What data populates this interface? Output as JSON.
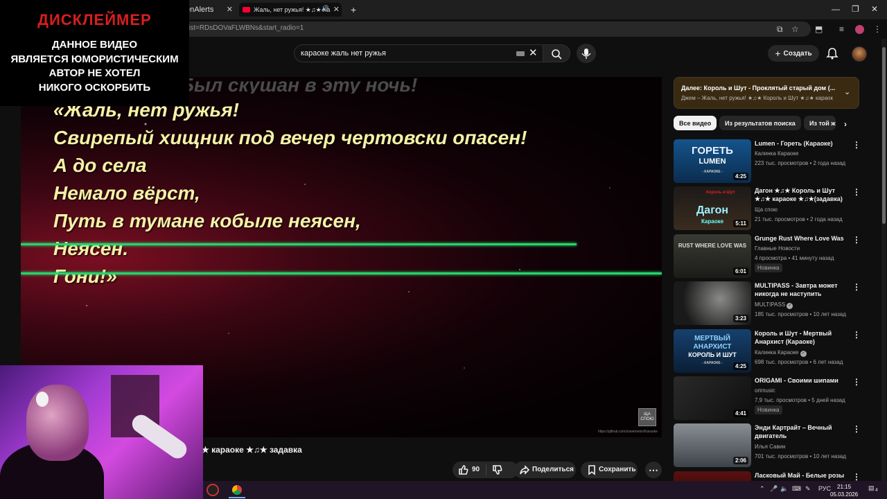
{
  "browser": {
    "tabs": [
      {
        "label": "enAlerts"
      },
      {
        "label": "Жаль, нет ружья! ★♫★ Ка"
      }
    ],
    "url": "ist=RDsDOVaFLWBNs&start_radio=1"
  },
  "header": {
    "search_query": "караоке жаль нет ружья",
    "create_label": "Создать"
  },
  "disclaimer": {
    "title": "ДИСКЛЕЙМЕР",
    "lines": [
      "ДАННОЕ ВИДЕО",
      "ЯВЛЯЕТСЯ ЮМОРИСТИЧЕСКИМ",
      "АВТОР НЕ ХОТЕЛ",
      "НИКОГО ОСКОРБИТЬ"
    ]
  },
  "player": {
    "prev_line": "Был скушан в эту ночь!",
    "lyrics": [
      "«Жаль, нет ружья!",
      "Свирепый хищник под вечер чертовски опасен!",
      "А до села",
      "Немало вёрст,",
      "Путь в тумане кобыле неясен,",
      "Неясен.",
      "Гони!»"
    ],
    "channel_badge": "ЩА СПОЮ",
    "small_url": "https://github.com/zowemenix/Karaoke"
  },
  "video": {
    "title": "★ караоке ★♫★ задавка",
    "likes": "90",
    "share_label": "Поделиться",
    "save_label": "Сохранить"
  },
  "upnext": {
    "title": "Далее: Король и Шут - Проклятый старый дом (...",
    "subtitle": "Джем – Жаль, нет ружья! ★♫★ Король и Шут ★♫★ караок"
  },
  "chips": [
    "Все видео",
    "Из результатов поиска",
    "Из той ж"
  ],
  "recommendations": [
    {
      "title": "Lumen - Гореть (Караоке)",
      "channel": "Калинка Караоке",
      "meta": "223 тыс. просмотров • 2 года назад",
      "duration": "4:25",
      "thumb_lines": [
        "ГОРЕТЬ",
        "LUMEN",
        "- КАРАОКЕ -"
      ]
    },
    {
      "title": "Дагон ★♫★ Король и Шут ★♫★ караоке ★♫★(задавка)",
      "channel": "Ща спою",
      "meta": "21 тыс. просмотров • 2 года назад",
      "duration": "5:11",
      "thumb_lines": [
        "Король и Шут",
        "Дагон",
        "Караоке"
      ]
    },
    {
      "title": "Grunge Rust Where Love Was",
      "channel": "Главные Новости",
      "meta": "4 просмотра • 41 минуту назад",
      "duration": "6:01",
      "badge": "Новинка",
      "thumb_lines": [
        "RUST WHERE LOVE WAS"
      ]
    },
    {
      "title": "MULTIPASS - Завтра может никогда не наступить",
      "channel": "MULTIPASS",
      "meta": "185 тыс. просмотров • 10 лет назад",
      "duration": "3:23",
      "verified": "✓"
    },
    {
      "title": "Король и Шут - Мертвый Анархист (Караоке)",
      "channel": "Калинка Караоке",
      "meta": "698 тыс. просмотров • 6 лет назад",
      "duration": "4:25",
      "verified": "✓",
      "thumb_lines": [
        "МЕРТВЫЙ",
        "АНАРХИСТ",
        "КОРОЛЬ И ШУТ",
        "- КАРАОКЕ -"
      ]
    },
    {
      "title": "ORIGAMI - Своими шипами",
      "channel": "orimusic",
      "meta": "7,9 тыс. просмотров • 5 дней назад",
      "duration": "4:41",
      "badge": "Новинка"
    },
    {
      "title": "Энди Картрайт – Вечный двигатель",
      "channel": "Илья Савин",
      "meta": "701 тыс. просмотров • 10 лет назад",
      "duration": "2:06"
    },
    {
      "title": "Ласковый Май - Белые розы",
      "channel": "",
      "meta": "",
      "duration": ""
    }
  ],
  "taskbar": {
    "lang": "РУС",
    "time": "21:15",
    "date": "05.03.2026",
    "notifications": "4"
  }
}
